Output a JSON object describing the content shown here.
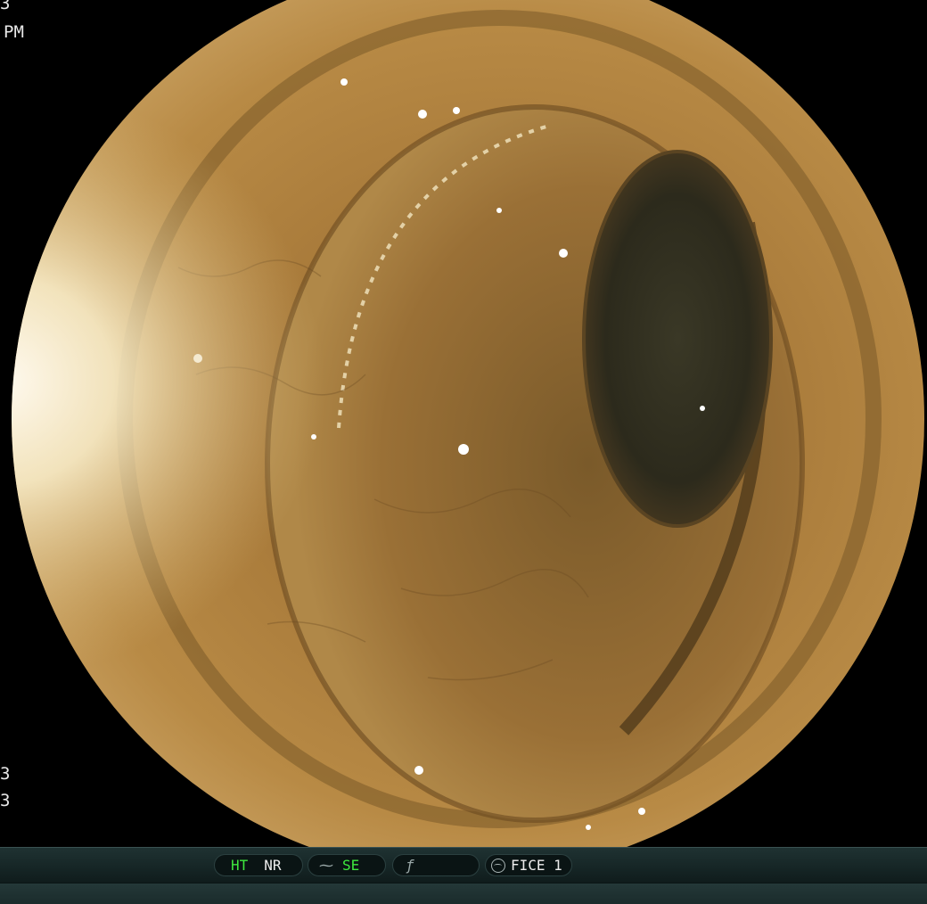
{
  "overlay": {
    "top_line_1": "3",
    "top_line_2": "PM",
    "bottom_line_1": "3",
    "bottom_line_2": "3"
  },
  "status_bar": {
    "hue_tone_label": "HT",
    "noise_reduction_label": "NR",
    "enhance_icon": "tilde-curve-icon",
    "structure_enhance_label": "SE",
    "mode_icon": "italic-f-icon",
    "mode_value": "",
    "fice_icon": "circle-wave-icon",
    "fice_label": "FICE 1"
  },
  "colors": {
    "active_green": "#3ee83e",
    "bar_background": "#1a2b2b",
    "text_white": "#ededed",
    "mucosa": "#a87a3a",
    "lumen": "#2c2a1c"
  }
}
